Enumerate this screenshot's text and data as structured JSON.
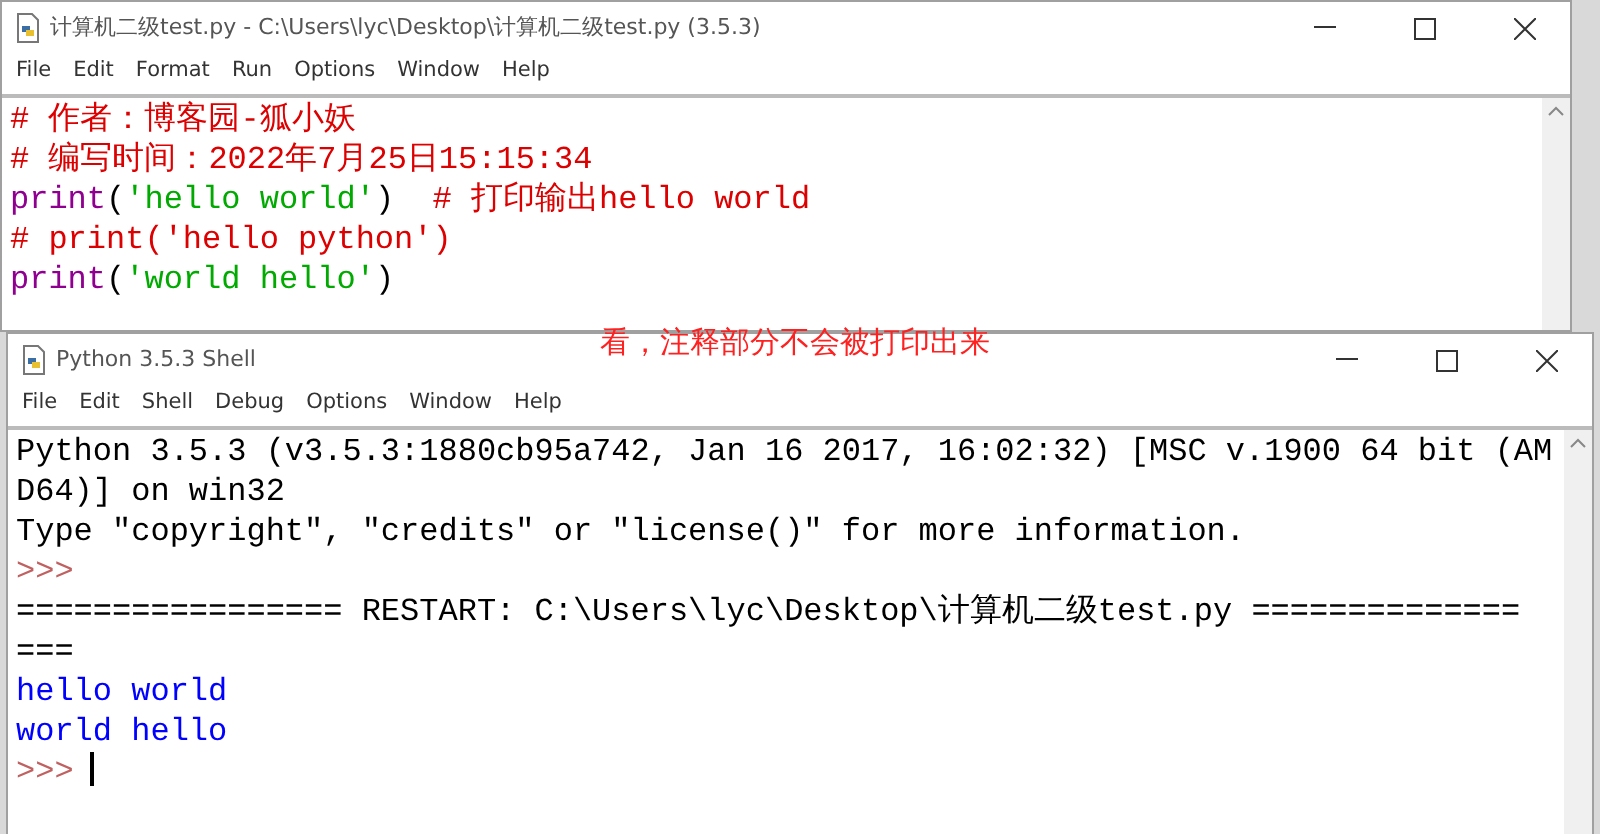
{
  "editor": {
    "title": "计算机二级test.py - C:\\Users\\lyc\\Desktop\\计算机二级test.py (3.5.3)",
    "menu": [
      "File",
      "Edit",
      "Format",
      "Run",
      "Options",
      "Window",
      "Help"
    ],
    "lines": [
      [
        {
          "kind": "comment",
          "text": "# 作者：博客园-狐小妖"
        }
      ],
      [
        {
          "kind": "comment",
          "text": "# 编写时间：2022年7月25日15:15:34"
        }
      ],
      [
        {
          "kind": "builtin",
          "text": "print"
        },
        {
          "kind": "plain",
          "text": "("
        },
        {
          "kind": "string",
          "text": "'hello world'"
        },
        {
          "kind": "plain",
          "text": ")  "
        },
        {
          "kind": "comment",
          "text": "# 打印输出hello world"
        }
      ],
      [
        {
          "kind": "comment",
          "text": "# print('hello python')"
        }
      ],
      [
        {
          "kind": "builtin",
          "text": "print"
        },
        {
          "kind": "plain",
          "text": "("
        },
        {
          "kind": "string",
          "text": "'world hello'"
        },
        {
          "kind": "plain",
          "text": ")"
        }
      ]
    ]
  },
  "annotation": "看，注释部分不会被打印出来",
  "shell": {
    "title": "Python 3.5.3 Shell",
    "menu": [
      "File",
      "Edit",
      "Shell",
      "Debug",
      "Options",
      "Window",
      "Help"
    ],
    "lines": [
      {
        "kind": "stdout",
        "text": "Python 3.5.3 (v3.5.3:1880cb95a742, Jan 16 2017, 16:02:32) [MSC v.1900 64 bit (AM"
      },
      {
        "kind": "stdout",
        "text": "D64)] on win32"
      },
      {
        "kind": "stdout",
        "text": "Type \"copyright\", \"credits\" or \"license()\" for more information."
      },
      {
        "kind": "prompt",
        "text": ">>>",
        "cursor": false
      },
      {
        "kind": "stdout",
        "text": "================= RESTART: C:\\Users\\lyc\\Desktop\\计算机二级test.py =============="
      },
      {
        "kind": "stdout",
        "text": "==="
      },
      {
        "kind": "output",
        "text": "hello world"
      },
      {
        "kind": "output",
        "text": "world hello"
      },
      {
        "kind": "prompt",
        "text": ">>>",
        "cursor": true
      }
    ]
  }
}
